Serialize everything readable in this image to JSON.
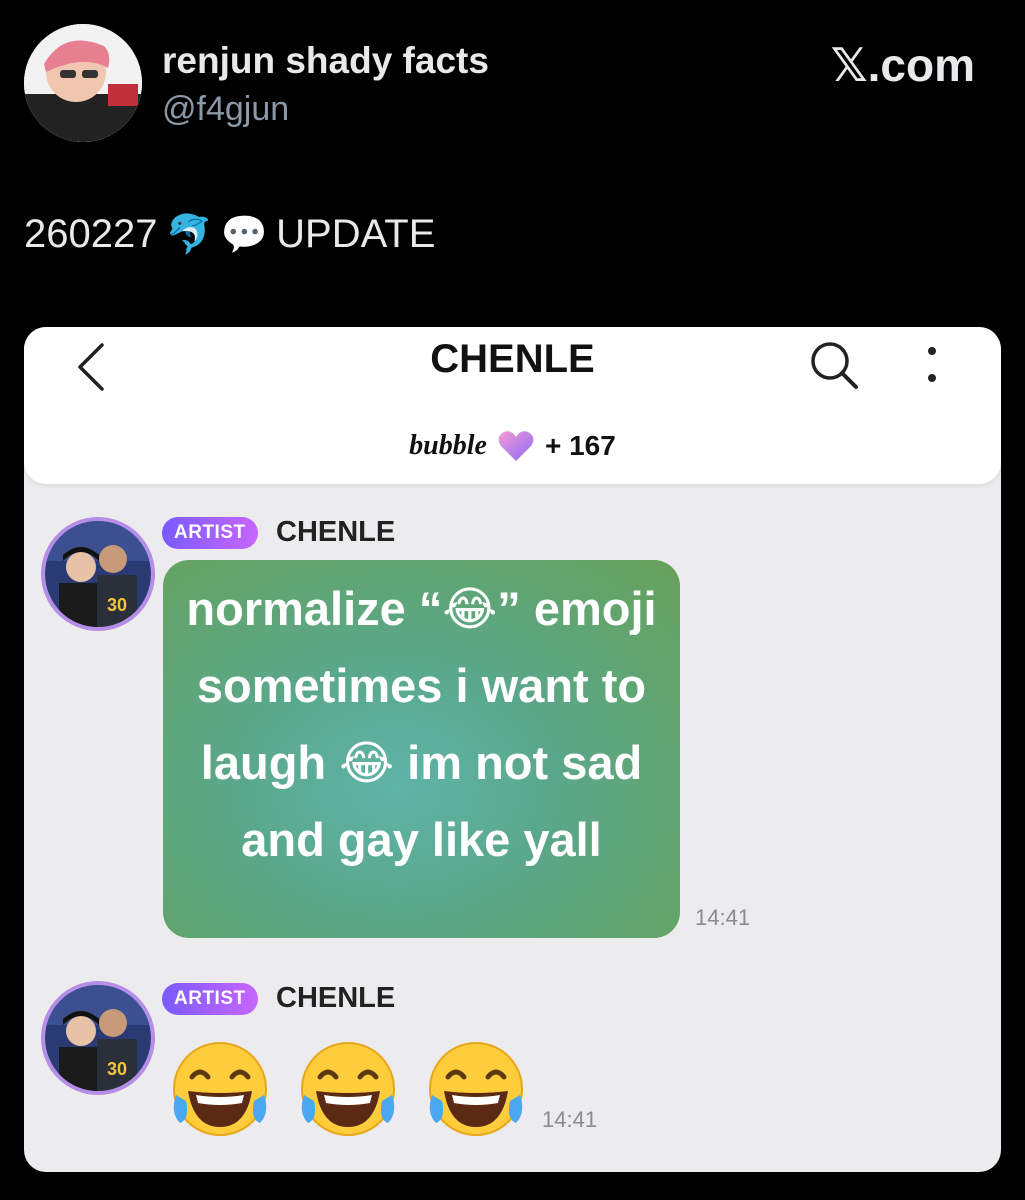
{
  "tweet": {
    "author_name": "renjun shady facts",
    "author_handle": "@f4gjun",
    "brand_glyph": "𝕏",
    "brand_text": ".com",
    "text_date": "260227",
    "text_emoji_1": "🐬",
    "text_emoji_2": "💬",
    "text_word": "UPDATE"
  },
  "chat": {
    "title": "CHENLE",
    "bubble_logo": "bubble",
    "member_count": "+ 167",
    "messages": [
      {
        "badge": "ARTIST",
        "sender": "CHENLE",
        "image_text": "normalize “😂” emoji sometimes i want to laugh 😂 im not sad and gay like yall",
        "time": "14:41"
      },
      {
        "badge": "ARTIST",
        "sender": "CHENLE",
        "emojis": [
          "laugh-cry-emoji",
          "laugh-cry-emoji",
          "laugh-cry-emoji"
        ],
        "time": "14:41"
      }
    ]
  },
  "colors": {
    "background": "#000000",
    "card": "#ececee",
    "badge_start": "#7a5bff",
    "badge_end": "#c866ff",
    "avatar_ring": "#b58de6"
  },
  "icons": [
    "back-icon",
    "search-icon",
    "more-icon",
    "heart-icon",
    "laugh-cry-emoji"
  ]
}
